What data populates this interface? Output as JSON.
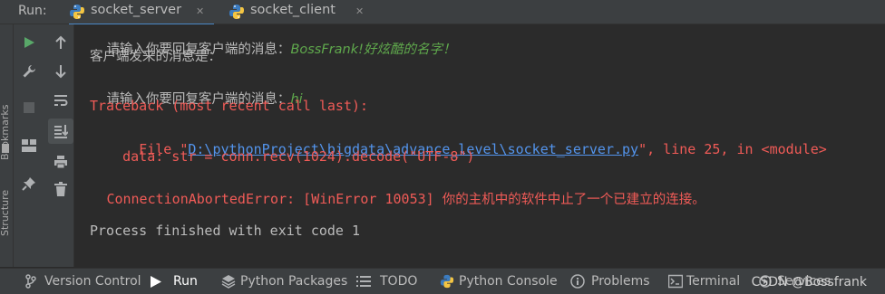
{
  "run_panel": {
    "label": "Run:",
    "tabs": [
      {
        "label": "socket_server",
        "active": true
      },
      {
        "label": "socket_client",
        "active": false
      }
    ]
  },
  "side_labels": {
    "bookmarks": "Bookmarks",
    "structure": "Structure"
  },
  "console": {
    "line1_prefix": "请输入你要回复客户端的消息：",
    "line1_reply": "BossFrank!好炫酷的名字！",
    "line2": "客户端发来的消息是：",
    "line3_prefix": "请输入你要回复客户端的消息：",
    "line3_reply": "hi",
    "traceback_header": "Traceback (most recent call last):",
    "file_prefix": "  File \"",
    "file_path": "D:\\pythonProject\\bigdata\\advance_level\\socket_server.py",
    "file_suffix": "\", line 25, in <module>",
    "code_line": "    data: str = conn.recv(1024).decode(\"UTF-8\")",
    "error_type": "ConnectionAbortedError: [WinError 10053] ",
    "error_msg": "你的主机中的软件中止了一个已建立的连接。",
    "exit_line": "Process finished with exit code 1"
  },
  "statusbar": {
    "items": [
      {
        "label": "Version Control"
      },
      {
        "label": "Run"
      },
      {
        "label": "Python Packages"
      },
      {
        "label": "TODO"
      },
      {
        "label": "Python Console"
      },
      {
        "label": "Problems"
      },
      {
        "label": "Terminal"
      },
      {
        "label": "Services"
      }
    ],
    "watermark": "CSDN @Bossfrank"
  },
  "colors": {
    "background": "#2b2b2b",
    "panel": "#3c3f41",
    "error_red": "#f05b57",
    "input_green": "#5fa84c",
    "link_blue": "#5394ec",
    "run_green": "#59a869",
    "active_tab_underline": "#4a88c7"
  }
}
